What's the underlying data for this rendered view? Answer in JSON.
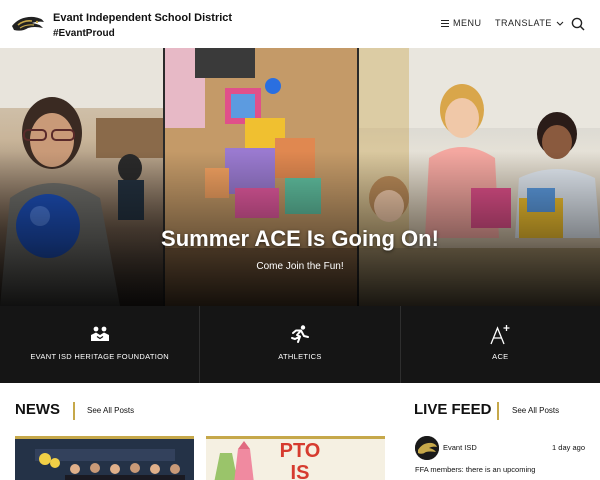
{
  "header": {
    "title": "Evant Independent School District",
    "tagline": "#EvantProud",
    "menu_label": "MENU",
    "translate_label": "TRANSLATE"
  },
  "hero": {
    "title": "Summer ACE Is Going On!",
    "subtitle": "Come Join the Fun!"
  },
  "quick_links": [
    {
      "label": "EVANT ISD HERITAGE FOUNDATION",
      "icon": "handshake-icon"
    },
    {
      "label": "ATHLETICS",
      "icon": "runner-icon"
    },
    {
      "label": "ACE",
      "icon": "a-plus-icon"
    }
  ],
  "news": {
    "heading": "NEWS",
    "see_all": "See All Posts",
    "card2_text": "PTO IS"
  },
  "live_feed": {
    "heading": "LIVE FEED",
    "see_all": "See All Posts",
    "post": {
      "author": "Evant ISD",
      "time": "1 day ago",
      "text": "FFA members: there is an upcoming"
    }
  },
  "colors": {
    "accent_gold": "#c6a84a",
    "quicklinks_bg": "#151515",
    "pto_red": "#d63b2f"
  }
}
